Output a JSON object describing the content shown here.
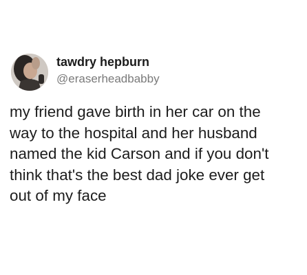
{
  "tweet": {
    "author": {
      "display_name": "tawdry hepburn",
      "handle": "@eraserheadbabby",
      "avatar_icon": "profile-photo"
    },
    "text_lines": [
      "my friend gave birth in her car on the",
      "way to the hospital and her husband",
      "named the kid Carson and if you don't",
      "think that's the best dad joke ever get",
      "out of my face"
    ]
  }
}
